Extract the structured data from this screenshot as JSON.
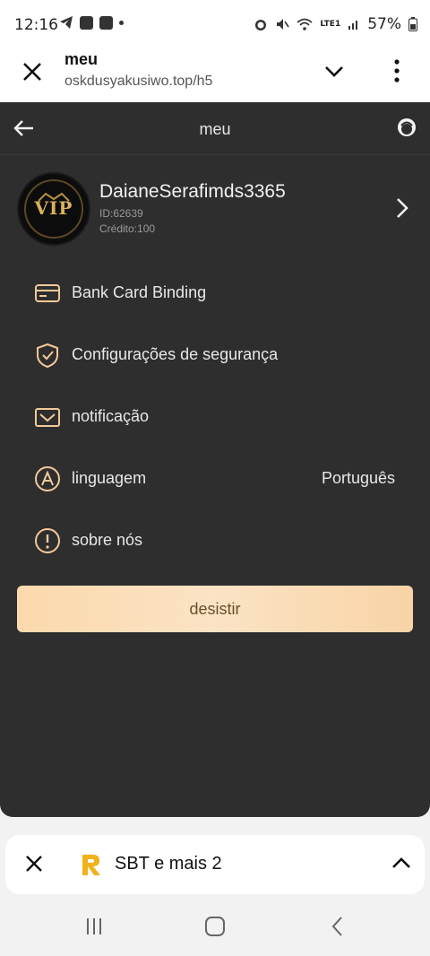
{
  "status_bar": {
    "time": "12:16",
    "battery": "57%",
    "network": "LTE1"
  },
  "browser": {
    "page_title": "meu",
    "url": "oskdusyakusiwo.top/h5"
  },
  "app": {
    "header_title": "meu",
    "profile": {
      "username": "DaianeSerafimds3365",
      "id_text": "ID:62639",
      "credit_text": "Crédito:100",
      "badge": "VIP"
    },
    "menu": [
      {
        "label": "Bank Card Binding",
        "icon": "card-icon",
        "value": ""
      },
      {
        "label": "Configurações de segurança",
        "icon": "shield-icon",
        "value": ""
      },
      {
        "label": "notificação",
        "icon": "mail-icon",
        "value": ""
      },
      {
        "label": "linguagem",
        "icon": "language-icon",
        "value": "Português"
      },
      {
        "label": "sobre nós",
        "icon": "info-icon",
        "value": ""
      }
    ],
    "logout_label": "desistir"
  },
  "bottom_card": {
    "title": "SBT e mais 2"
  },
  "colors": {
    "app_bg": "#2e2e2e",
    "accent": "#f3d1a6",
    "icon_accent": "#f2c99a",
    "text_light": "#e8e8e8"
  }
}
